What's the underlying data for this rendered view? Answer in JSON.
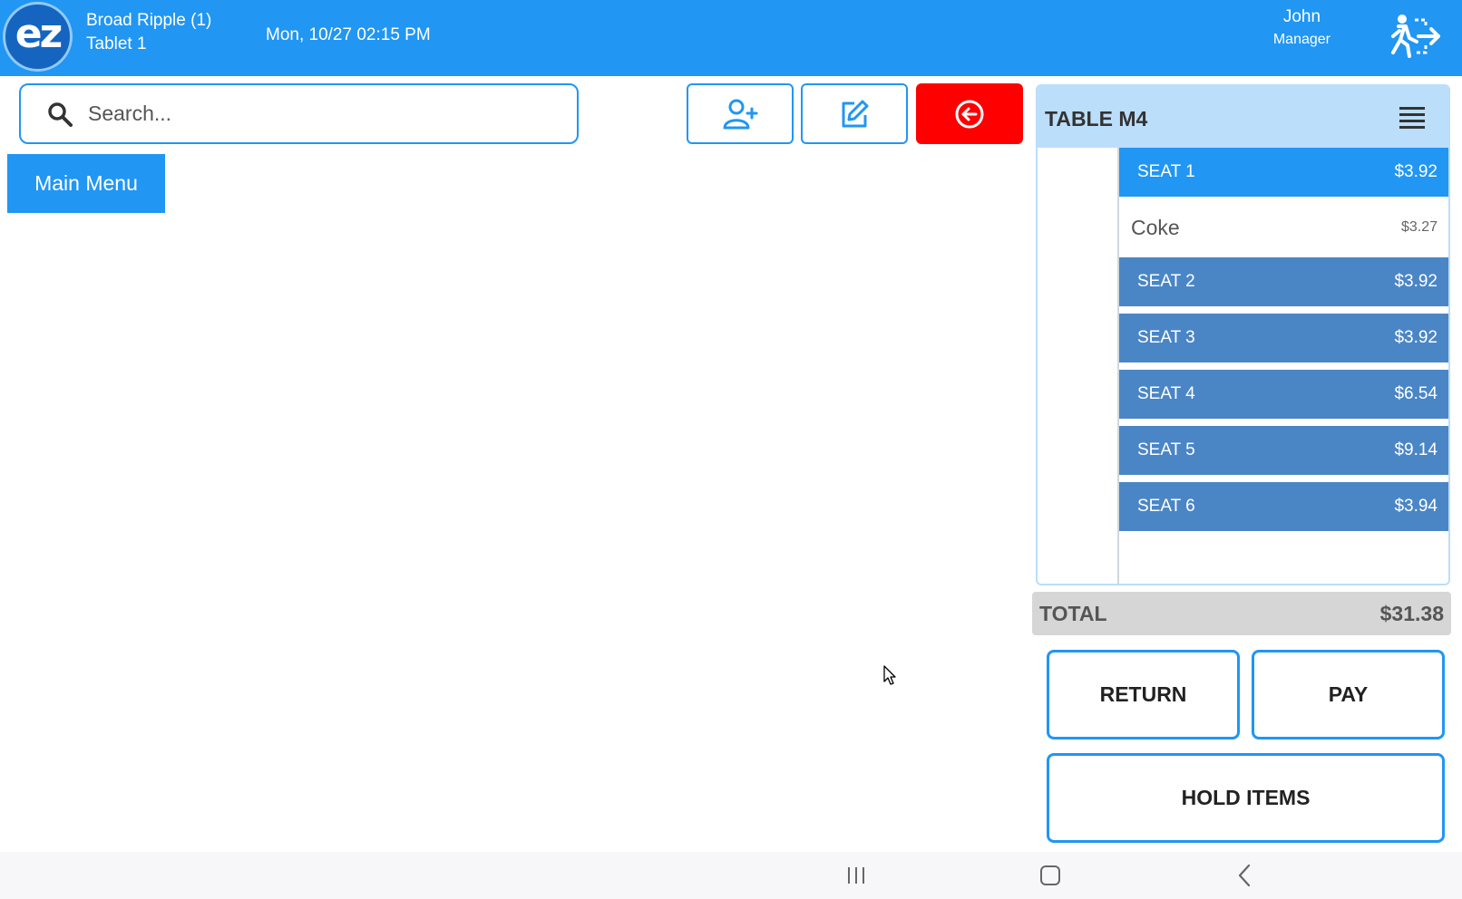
{
  "header": {
    "logo_text": "ez",
    "store_name": "Broad Ripple (1)",
    "device_name": "Tablet 1",
    "datetime": "Mon, 10/27 02:15 PM",
    "user_name": "John",
    "user_role": "Manager",
    "color": "#2196f3"
  },
  "search": {
    "placeholder": "Search..."
  },
  "main_menu_label": "Main Menu",
  "order": {
    "title": "TABLE M4",
    "seats": [
      {
        "label": "SEAT 1",
        "amount": "$3.92"
      },
      {
        "label": "SEAT 2",
        "amount": "$3.92"
      },
      {
        "label": "SEAT 3",
        "amount": "$3.92"
      },
      {
        "label": "SEAT 4",
        "amount": "$6.54"
      },
      {
        "label": "SEAT 5",
        "amount": "$9.14"
      },
      {
        "label": "SEAT 6",
        "amount": "$3.94"
      }
    ],
    "items": [
      {
        "name": "Coke",
        "price": "$3.27"
      }
    ],
    "total_label": "TOTAL",
    "total_value": "$31.38"
  },
  "buttons": {
    "return": "RETURN",
    "pay": "PAY",
    "hold": "HOLD ITEMS"
  },
  "icons": {
    "add_customer": "add-user-icon",
    "edit": "edit-icon",
    "back": "circle-arrow-left-icon",
    "menu": "hamburger-icon",
    "logout": "exit-icon"
  },
  "colors": {
    "accent": "#2196f3",
    "seat": "#4a86c5",
    "danger": "#ff0000",
    "panel_header": "#bbdefb"
  }
}
